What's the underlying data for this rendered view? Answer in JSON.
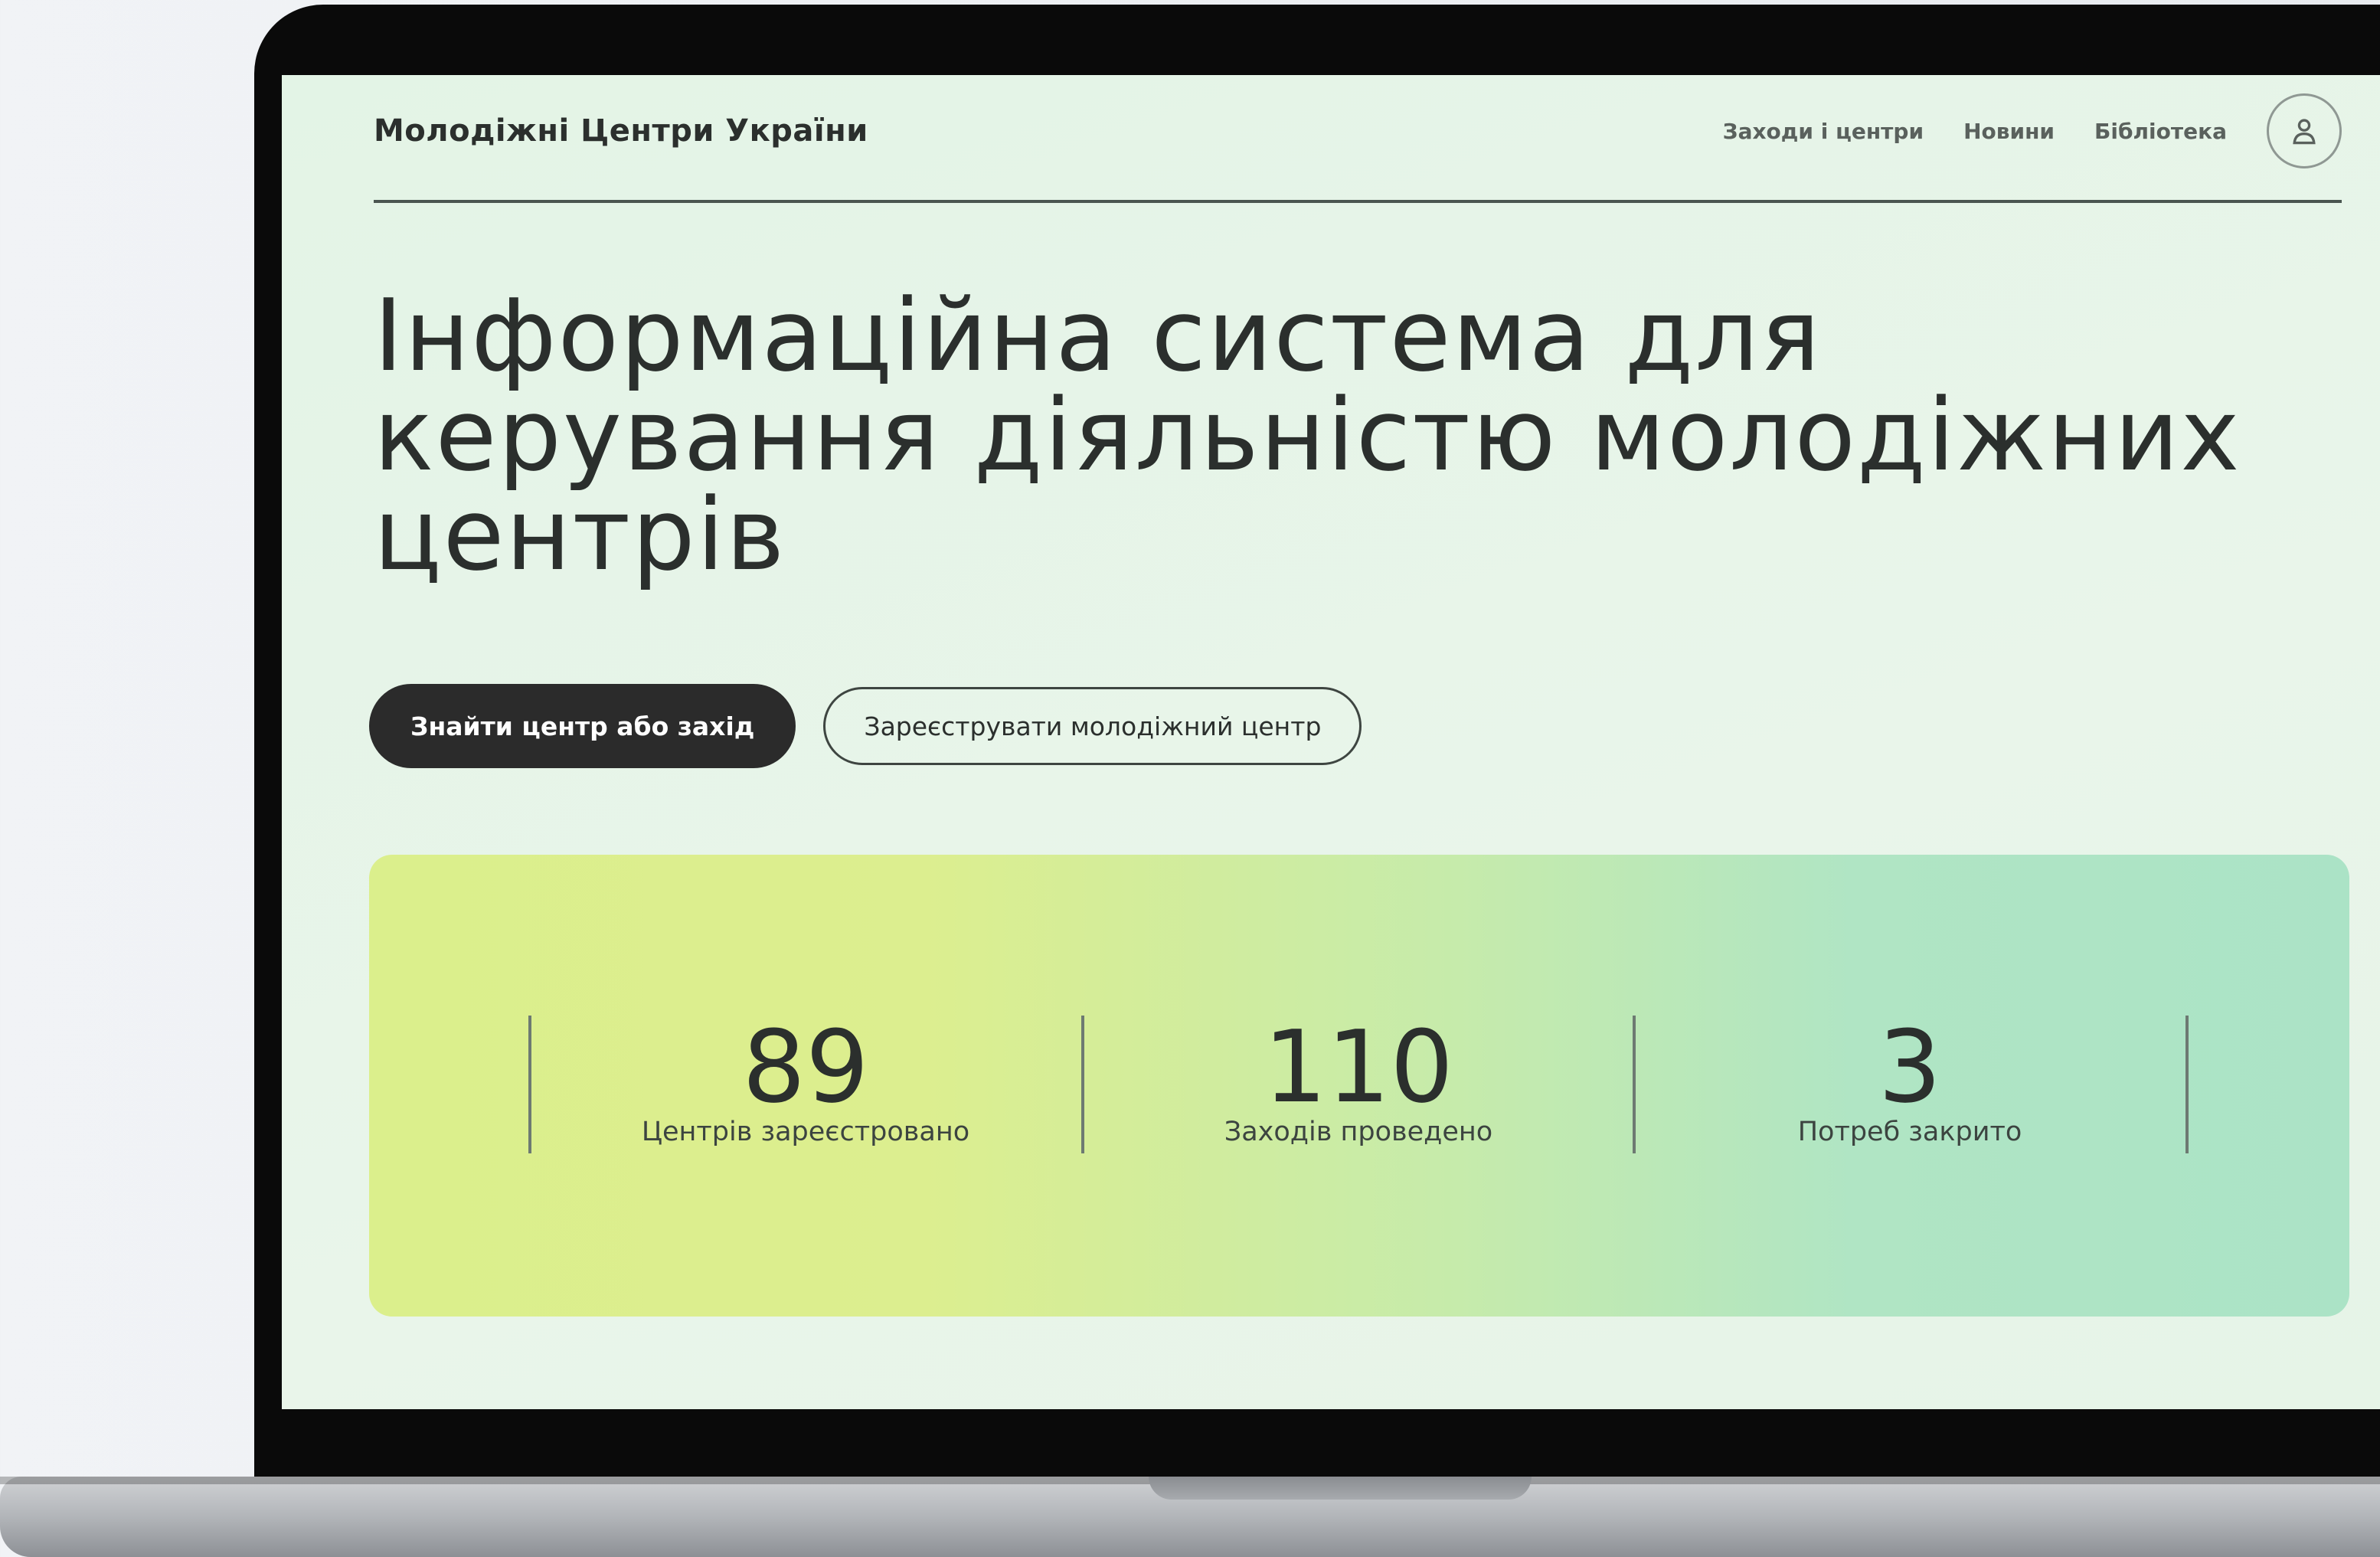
{
  "header": {
    "brand": "Молодіжні Центри України",
    "nav": [
      "Заходи і центри",
      "Новини",
      "Бібліотека"
    ]
  },
  "hero": {
    "title": "Інформаційна система для керування діяльністю молодіжних центрів",
    "primary_button": "Знайти центр або захід",
    "secondary_button": "Зареєструвати молодіжний центр"
  },
  "stats": [
    {
      "value": "89",
      "label": "Центрів зареєстровано"
    },
    {
      "value": "110",
      "label": "Заходів проведено"
    },
    {
      "value": "3",
      "label": "Потреб закрито"
    }
  ],
  "icons": {
    "profile": "user-icon"
  },
  "colors": {
    "text_dark": "#2b2f2d",
    "button_dark": "#2b2b2b",
    "gradient_start": "#dbef8c",
    "gradient_end": "#abe3c6",
    "page_background": "#e6f4e8"
  }
}
